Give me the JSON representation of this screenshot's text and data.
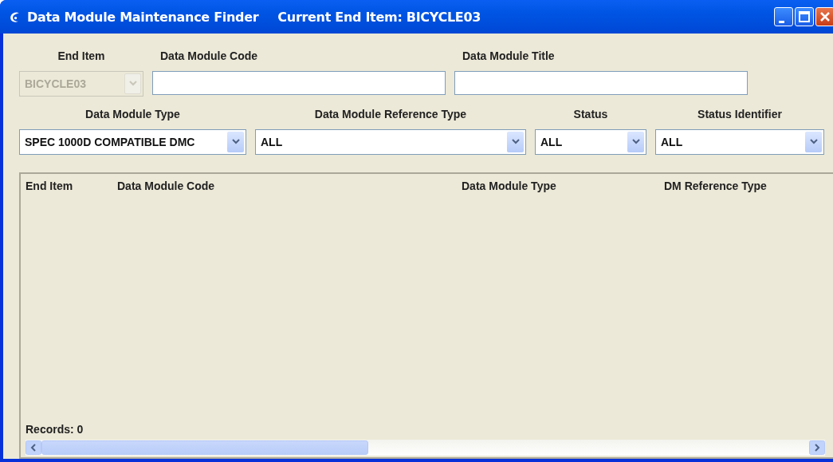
{
  "window": {
    "title": "Data Module Maintenance Finder",
    "subtitle": "Current End Item: BICYCLE03"
  },
  "filters_row_1": [
    {
      "kind": "combo",
      "label": "End Item",
      "value": "BICYCLE03",
      "disabled": true
    },
    {
      "kind": "text",
      "label": "Data Module Code"
    },
    {
      "kind": "text",
      "label": "Data Module Title"
    }
  ],
  "filters_row_2": [
    {
      "kind": "combo",
      "label": "Data Module Type",
      "value": "SPEC 1000D COMPATIBLE DMC",
      "disabled": false
    },
    {
      "kind": "combo",
      "label": "Data Module Reference Type",
      "value": "ALL",
      "disabled": false
    },
    {
      "kind": "combo",
      "label": "Status",
      "value": "ALL",
      "disabled": false
    },
    {
      "kind": "combo",
      "label": "Status Identifier",
      "value": "ALL",
      "disabled": false
    }
  ],
  "table": {
    "columns": [
      "End Item",
      "Data Module Code",
      "Data Module Type",
      "DM Reference Type"
    ]
  },
  "status_bar": {
    "records": "Records: 0"
  }
}
